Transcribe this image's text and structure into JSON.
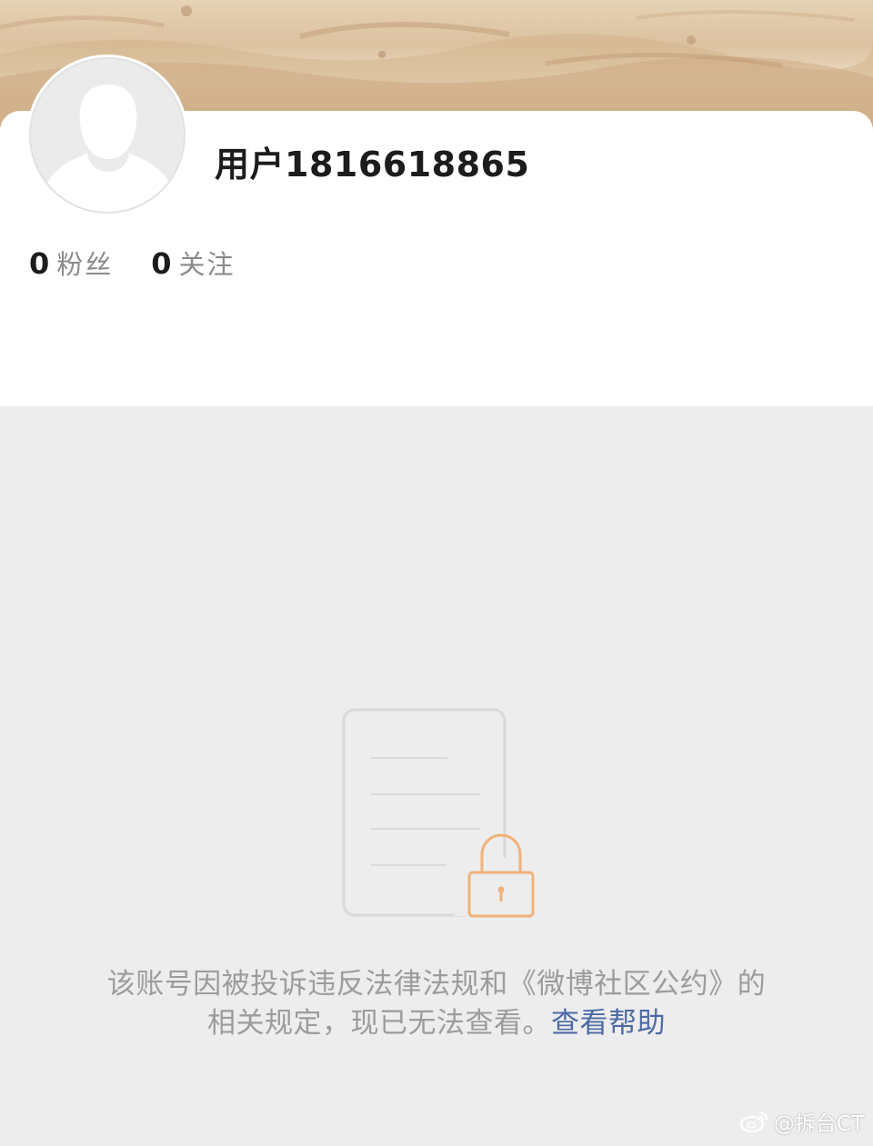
{
  "profile": {
    "username": "用户1816618865",
    "stats": [
      {
        "count": "0",
        "label": "粉丝"
      },
      {
        "count": "0",
        "label": "关注"
      }
    ]
  },
  "notice": {
    "line1": "该账号因被投诉违反法律法规和《微博社区公约》的",
    "line2_text": "相关规定，现已无法查看。",
    "help_link": "查看帮助"
  },
  "watermark": {
    "text": "@拆台CT",
    "icon": "weibo-logo-icon"
  },
  "colors": {
    "page_background": "#ededed",
    "card_background": "#ffffff",
    "link": "#4d6aa6",
    "lock_accent": "#f0b27a",
    "muted_text": "#9c9c9c"
  }
}
